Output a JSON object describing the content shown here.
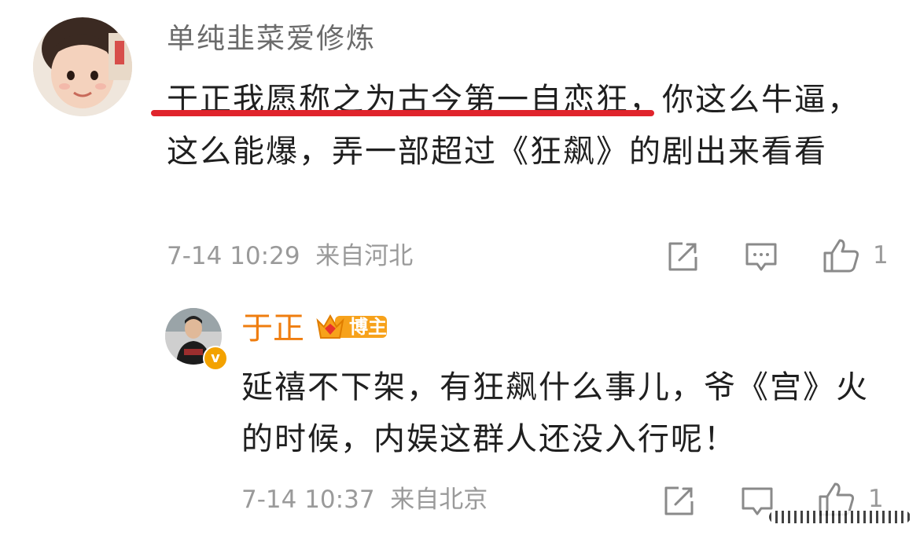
{
  "comment": {
    "username": "单纯韭菜爱修炼",
    "text_highlight": "于正我愿称之为古今第一自恋狂",
    "text_rest": "，你这么牛逼，这么能爆，弄一部超过《狂飙》的剧出来看看",
    "timestamp": "7-14 10:29",
    "location": "来自河北",
    "like_count": "1",
    "colors": {
      "underline": "#e0242c",
      "meta": "#9a9a9a"
    }
  },
  "reply": {
    "username": "于正",
    "badge_label": "博主",
    "text": "延禧不下架，有狂飙什么事儿，爷《宫》火的时候，内娱这群人还没入行呢！",
    "timestamp": "7-14 10:37",
    "location": "来自北京",
    "like_count": "1",
    "colors": {
      "username": "#ef7d0f",
      "badge": "#f39a15"
    }
  },
  "icons": [
    "share-icon",
    "comment-icon",
    "like-icon",
    "verified-v-icon",
    "crown-icon"
  ]
}
